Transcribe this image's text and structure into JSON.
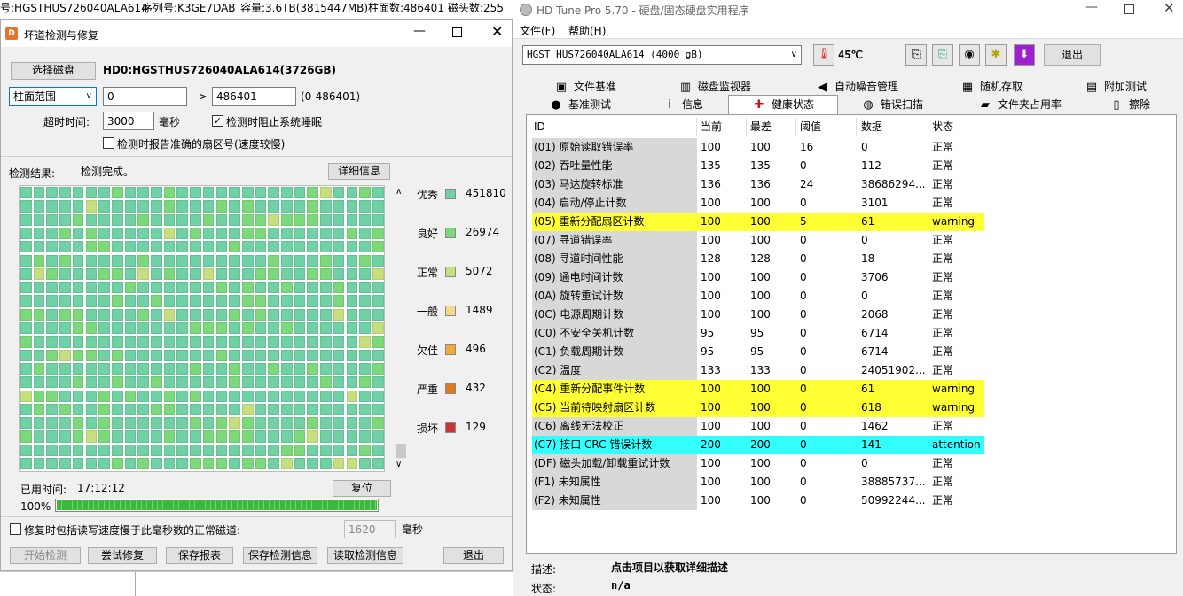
{
  "top_strip": {
    "model_text": "号:HGSTHUS726040ALA614",
    "serial_text": "序列号:K3GE7DAB",
    "capacity_text": "容量:3.6TB(3815447MB)",
    "cylinders_text": "柱面数:486401",
    "heads_text": "磁头数:255"
  },
  "left_window": {
    "title": "坏道检测与修复",
    "select_disk_label": "选择磁盘",
    "disk_name": "HD0:HGSTHUS726040ALA614(3726GB)",
    "range_type": "柱面范围",
    "range_start": "0",
    "arrow_text": "-->",
    "range_end": "486401",
    "range_hint": "(0-486401)",
    "timeout_label": "超时时间:",
    "timeout_value": "3000",
    "timeout_unit": "毫秒",
    "prevent_sleep_label": "检测时阻止系统睡眠",
    "report_sector_label": "检测时报告准确的扇区号(速度较慢)",
    "result_label": "检测结果:",
    "result_text": "检测完成。",
    "detail_button": "详细信息",
    "legend": [
      {
        "label": "优秀",
        "count": "451810",
        "color": "#6fd1a4"
      },
      {
        "label": "良好",
        "count": "26974",
        "color": "#7cd97b"
      },
      {
        "label": "正常",
        "count": "5072",
        "color": "#c5de7e"
      },
      {
        "label": "一般",
        "count": "1489",
        "color": "#f2d98a"
      },
      {
        "label": "欠佳",
        "count": "496",
        "color": "#f2a93b"
      },
      {
        "label": "严重",
        "count": "432",
        "color": "#e07a1a"
      },
      {
        "label": "损坏",
        "count": "129",
        "color": "#c73535"
      }
    ],
    "elapsed_label": "已用时间:",
    "elapsed_value": "17:12:12",
    "reset_button": "复位",
    "progress_text": "100%",
    "progress": 1.0,
    "repair_slow_label": "修复时包括读写速度慢于此毫秒数的正常磁道:",
    "repair_slow_value": "1620",
    "repair_slow_unit": "毫秒",
    "buttons": {
      "start": "开始检测",
      "try_repair": "尝试修复",
      "save_report": "保存报表",
      "save_info": "保存检测信息",
      "read_info": "读取检测信息",
      "exit": "退出"
    }
  },
  "right_window": {
    "title": "HD Tune Pro 5.70 - 硬盘/固态硬盘实用程序",
    "menu": [
      "文件(F)",
      "帮助(H)"
    ],
    "drive": "HGST  HUS726040ALA614 (4000 gB)",
    "temperature": "45℃",
    "exit_button": "退出",
    "tabs_row1": [
      {
        "label": "文件基准",
        "icon": "file-benchmark-icon",
        "glyph": "▣"
      },
      {
        "label": "磁盘监视器",
        "icon": "disk-monitor-icon",
        "glyph": "▥"
      },
      {
        "label": "自动噪音管理",
        "icon": "speaker-icon",
        "glyph": "◀"
      },
      {
        "label": "随机存取",
        "icon": "random-access-icon",
        "glyph": "▦"
      },
      {
        "label": "附加测试",
        "icon": "extra-tests-icon",
        "glyph": "▤"
      }
    ],
    "tabs_row2": [
      {
        "label": "基准测试",
        "icon": "bulb-icon",
        "glyph": "●"
      },
      {
        "label": "信息",
        "icon": "info-icon",
        "glyph": "i"
      },
      {
        "label": "健康状态",
        "icon": "health-cross-icon",
        "glyph": "✚"
      },
      {
        "label": "错误扫描",
        "icon": "magnifier-icon",
        "glyph": "◍"
      },
      {
        "label": "文件夹占用率",
        "icon": "folder-icon",
        "glyph": "▰"
      },
      {
        "label": "擦除",
        "icon": "trash-icon",
        "glyph": "▯"
      }
    ],
    "table": {
      "headers": [
        "ID",
        "当前",
        "最差",
        "阈值",
        "数据",
        "状态"
      ],
      "rows": [
        [
          "(01) 原始读取错误率",
          "100",
          "100",
          "16",
          "0",
          "正常",
          ""
        ],
        [
          "(02) 吞吐量性能",
          "135",
          "135",
          "0",
          "112",
          "正常",
          ""
        ],
        [
          "(03) 马达旋转标准",
          "136",
          "136",
          "24",
          "38686294...",
          "正常",
          ""
        ],
        [
          "(04) 启动/停止计数",
          "100",
          "100",
          "0",
          "3101",
          "正常",
          ""
        ],
        [
          "(05) 重新分配扇区计数",
          "100",
          "100",
          "5",
          "61",
          "warning",
          "#ffff33"
        ],
        [
          "(07) 寻道错误率",
          "100",
          "100",
          "0",
          "0",
          "正常",
          ""
        ],
        [
          "(08) 寻道时间性能",
          "128",
          "128",
          "0",
          "18",
          "正常",
          ""
        ],
        [
          "(09) 通电时间计数",
          "100",
          "100",
          "0",
          "3706",
          "正常",
          ""
        ],
        [
          "(0A) 旋转重试计数",
          "100",
          "100",
          "0",
          "0",
          "正常",
          ""
        ],
        [
          "(0C) 电源周期计数",
          "100",
          "100",
          "0",
          "2068",
          "正常",
          ""
        ],
        [
          "(C0) 不安全关机计数",
          "95",
          "95",
          "0",
          "6714",
          "正常",
          ""
        ],
        [
          "(C1) 负载周期计数",
          "95",
          "95",
          "0",
          "6714",
          "正常",
          ""
        ],
        [
          "(C2) 温度",
          "133",
          "133",
          "0",
          "24051902...",
          "正常",
          ""
        ],
        [
          "(C4) 重新分配事件计数",
          "100",
          "100",
          "0",
          "61",
          "warning",
          "#ffff33"
        ],
        [
          "(C5) 当前待映射扇区计数",
          "100",
          "100",
          "0",
          "618",
          "warning",
          "#ffff33"
        ],
        [
          "(C6) 离线无法校正",
          "100",
          "100",
          "0",
          "1462",
          "正常",
          ""
        ],
        [
          "(C7) 接口 CRC 错误计数",
          "200",
          "200",
          "0",
          "141",
          "attention",
          "#33ffff"
        ],
        [
          "(DF) 磁头加载/卸载重试计数",
          "100",
          "100",
          "0",
          "0",
          "正常",
          ""
        ],
        [
          "(F1) 未知属性",
          "100",
          "100",
          "0",
          "38885737...",
          "正常",
          ""
        ],
        [
          "(F2) 未知属性",
          "100",
          "100",
          "0",
          "50992244...",
          "正常",
          ""
        ]
      ]
    },
    "description_label": "描述:",
    "description_value": "点击项目以获取详细描述",
    "status_label": "状态:",
    "status_value": "n/a"
  }
}
